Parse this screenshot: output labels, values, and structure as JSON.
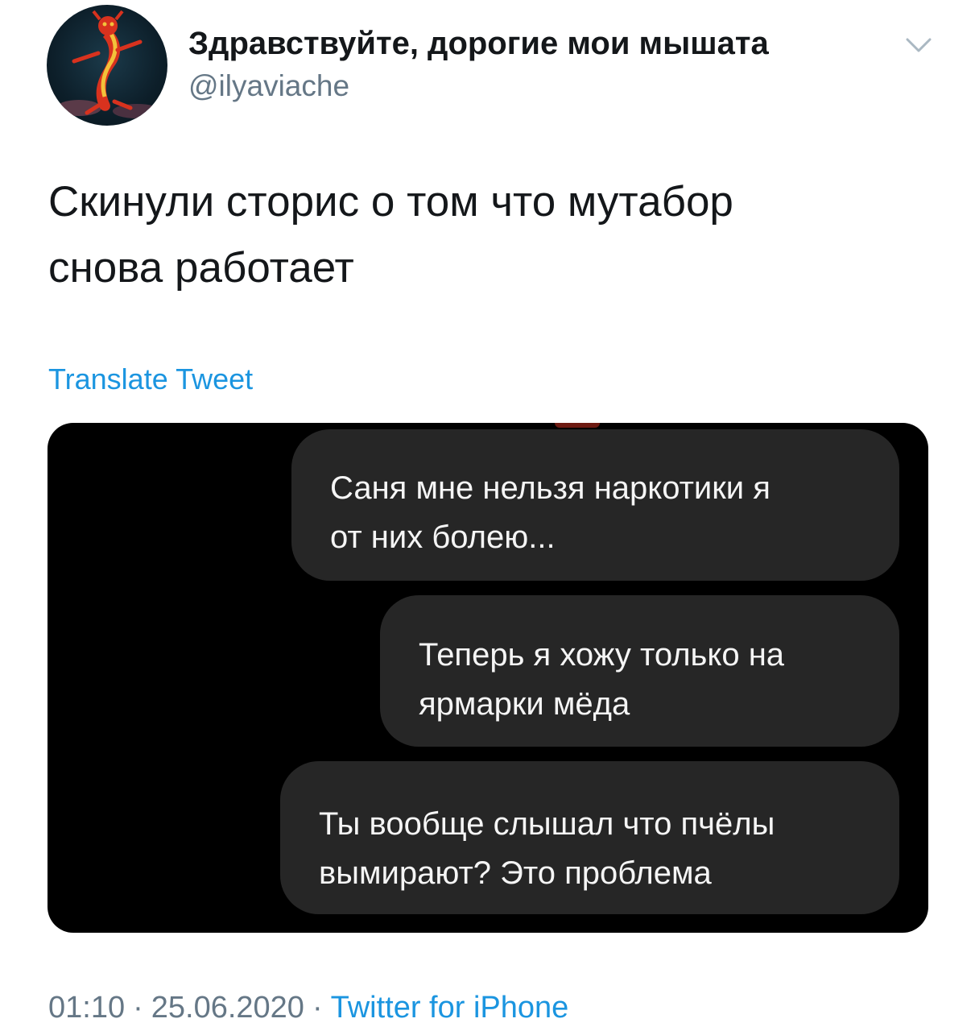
{
  "tweet": {
    "display_name": "Здравствуйте, дорогие мои мышата",
    "handle": "@ilyaviache",
    "avatar_icon": "cartoon-dragon-avatar",
    "menu_icon": "chevron-down-icon",
    "text": "Скинули сторис о том что мутабор\nснова работает",
    "translate_label": "Translate Tweet",
    "media": {
      "messages": [
        "Саня мне нельзя наркотики я\nот них болею...",
        "Теперь я хожу только на\nярмарки мёда",
        "Ты вообще слышал что пчёлы\nвымирают? Это проблема"
      ]
    },
    "footer": {
      "time": "01:10",
      "separator": "·",
      "date": "25.06.2020",
      "source": "Twitter for iPhone"
    }
  },
  "colors": {
    "text": "#14171a",
    "secondary": "#657786",
    "link": "#1b95e0",
    "media_bg": "#000000",
    "bubble_bg": "#262626",
    "bubble_text": "#f5f5f5"
  }
}
